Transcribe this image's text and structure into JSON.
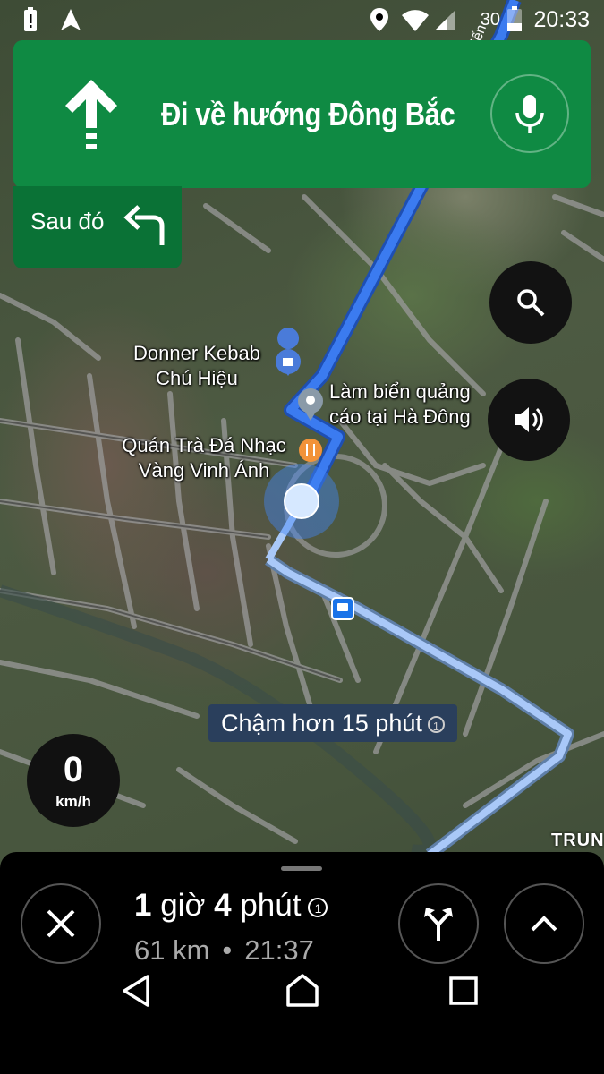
{
  "status_bar": {
    "time": "20:33",
    "battery_percent": "30",
    "icons": [
      "battery-alert-icon",
      "navigation-arrow-icon",
      "location-pin-icon",
      "wifi-icon",
      "signal-icon"
    ]
  },
  "navigation": {
    "direction_icon": "straight-arrow-icon",
    "instruction": "Đi về hướng Đông Bắc",
    "then_label": "Sau đó",
    "then_icon": "turn-left-icon",
    "mic_icon": "microphone-icon"
  },
  "map": {
    "places": [
      {
        "name": "Donner Kebab\nChú Hiệu",
        "icon": "shopping-bag-pin-icon"
      },
      {
        "name": "Làm biển quảng\ncáo tại Hà Đông",
        "icon": "location-pin-icon"
      },
      {
        "name": "Quán Trà Đá Nhạc\nVàng Vinh Ánh",
        "icon": "restaurant-pin-icon"
      }
    ],
    "alternate_route_label": "Chậm hơn 15 phút",
    "road_label_partial": "TRUN",
    "corner_text_partial": "iến"
  },
  "controls": {
    "search_icon": "search-icon",
    "sound_icon": "speaker-icon"
  },
  "speedometer": {
    "value": "0",
    "unit": "km/h"
  },
  "trip": {
    "duration_hours": "1",
    "hours_word": "giờ",
    "duration_minutes": "4",
    "minutes_word": "phút",
    "distance": "61 km",
    "separator": "•",
    "arrival": "21:37",
    "close_icon": "close-icon",
    "alt_routes_icon": "alternate-routes-icon",
    "expand_icon": "chevron-up-icon"
  },
  "system_nav": {
    "back_icon": "back-triangle-icon",
    "home_icon": "home-icon",
    "recents_icon": "recents-square-icon"
  },
  "colors": {
    "nav_green": "#0f8a43",
    "nav_green_dark": "#0a7236",
    "route_blue": "#3b7bf0",
    "alt_route_blue": "#a9c8f8",
    "location_blue": "#4285f4"
  }
}
